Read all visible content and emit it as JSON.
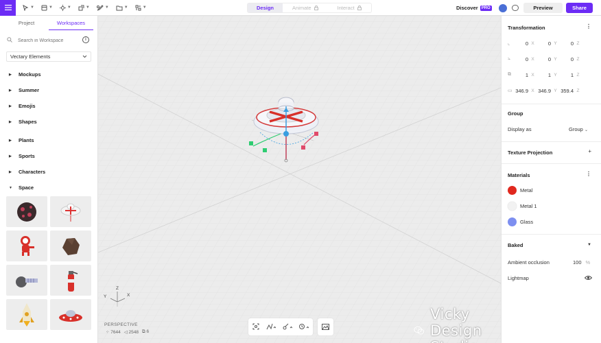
{
  "topbar": {
    "tools": [
      "menu-icon",
      "select-tool-icon",
      "frame-tool-icon",
      "light-tool-icon",
      "transform-tool-icon",
      "pen-tool-icon",
      "folder-icon",
      "grid-tool-icon"
    ],
    "modes": {
      "design": "Design",
      "animate": "Animate",
      "interact": "Interact"
    },
    "discover": "Discover",
    "pro_badge": "PRO",
    "preview_label": "Preview",
    "share_label": "Share",
    "accent": "#6c2cf5"
  },
  "left": {
    "tabs": {
      "project": "Project",
      "workspaces": "Workspaces"
    },
    "search_placeholder": "Search in Workspace",
    "library": "Vectary Elements",
    "categories": [
      "Mockups",
      "Summer",
      "Emojis",
      "Shapes",
      "Plants",
      "Sports",
      "Characters",
      "Space"
    ]
  },
  "viewport": {
    "camera": "PERSPECTIVE",
    "stats": {
      "vertices": "7644",
      "faces": "2548",
      "objects": "6"
    },
    "axes": {
      "x": "X",
      "y": "Y",
      "z": "Z"
    },
    "watermark": "Vicky Design Studio"
  },
  "right": {
    "transformation": {
      "title": "Transformation",
      "position": {
        "x": "0",
        "y": "0",
        "z": "0"
      },
      "rotation": {
        "x": "0",
        "y": "0",
        "z": "0"
      },
      "scale": {
        "x": "1",
        "y": "1",
        "z": "1"
      },
      "size": {
        "x": "346.9",
        "y": "346.9",
        "z": "359.4"
      },
      "axis_labels": {
        "x": "X",
        "y": "Y",
        "z": "Z"
      }
    },
    "group": {
      "title": "Group",
      "display_as_label": "Display as",
      "display_as_value": "Group"
    },
    "texture_projection": {
      "title": "Texture Projection"
    },
    "materials": {
      "title": "Materials",
      "items": [
        {
          "name": "Metal",
          "color": "#e0281e"
        },
        {
          "name": "Metal 1",
          "color": "#f2f2f2"
        },
        {
          "name": "Glass",
          "color": "#7d8ff0"
        }
      ]
    },
    "baked": {
      "title": "Baked",
      "ambient_label": "Ambient occlusion",
      "ambient_value": "100",
      "ambient_unit": "%",
      "lightmap_label": "Lightmap"
    }
  }
}
